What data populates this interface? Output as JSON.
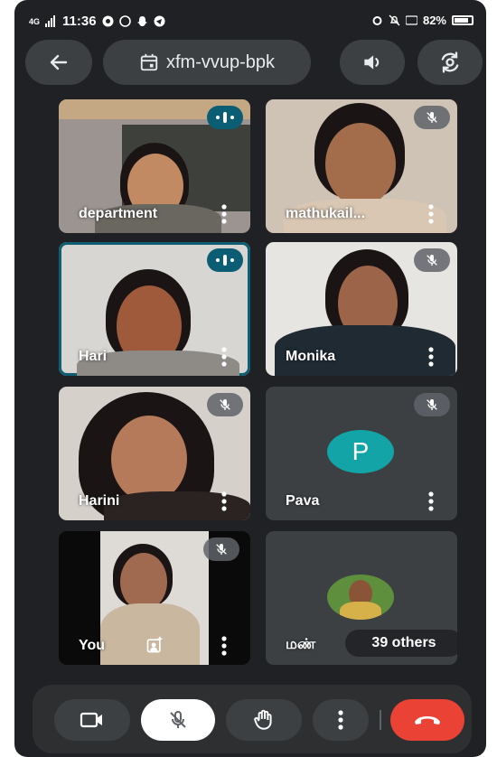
{
  "status": {
    "network": "4G",
    "time": "11:36",
    "battery": "82%"
  },
  "topbar": {
    "meeting_code": "xfm-vvup-bpk"
  },
  "tiles": [
    {
      "name": "department",
      "state": "speaking"
    },
    {
      "name": "mathukail...",
      "state": "muted"
    },
    {
      "name": "Hari",
      "state": "speaking"
    },
    {
      "name": "Monika",
      "state": "muted"
    },
    {
      "name": "Harini",
      "state": "muted"
    },
    {
      "name": "Pava",
      "state": "muted",
      "avatar_letter": "P"
    },
    {
      "name": "You",
      "state": "muted"
    },
    {
      "name": "மண்",
      "others_label": "39 others"
    }
  ],
  "colors": {
    "background": "#202124",
    "tile": "#3c4043",
    "speaking": "#0b5d73",
    "end_call": "#ea4335",
    "avatar_p": "#12a4a6"
  },
  "icons": {
    "back": "arrow-left-icon",
    "meeting": "calendar-icon",
    "speaker": "volume-icon",
    "flip": "camera-flip-icon",
    "camera": "video-camera-icon",
    "mic": "mic-off-icon",
    "hand": "raise-hand-icon",
    "more": "more-vertical-icon",
    "end": "call-end-icon"
  }
}
